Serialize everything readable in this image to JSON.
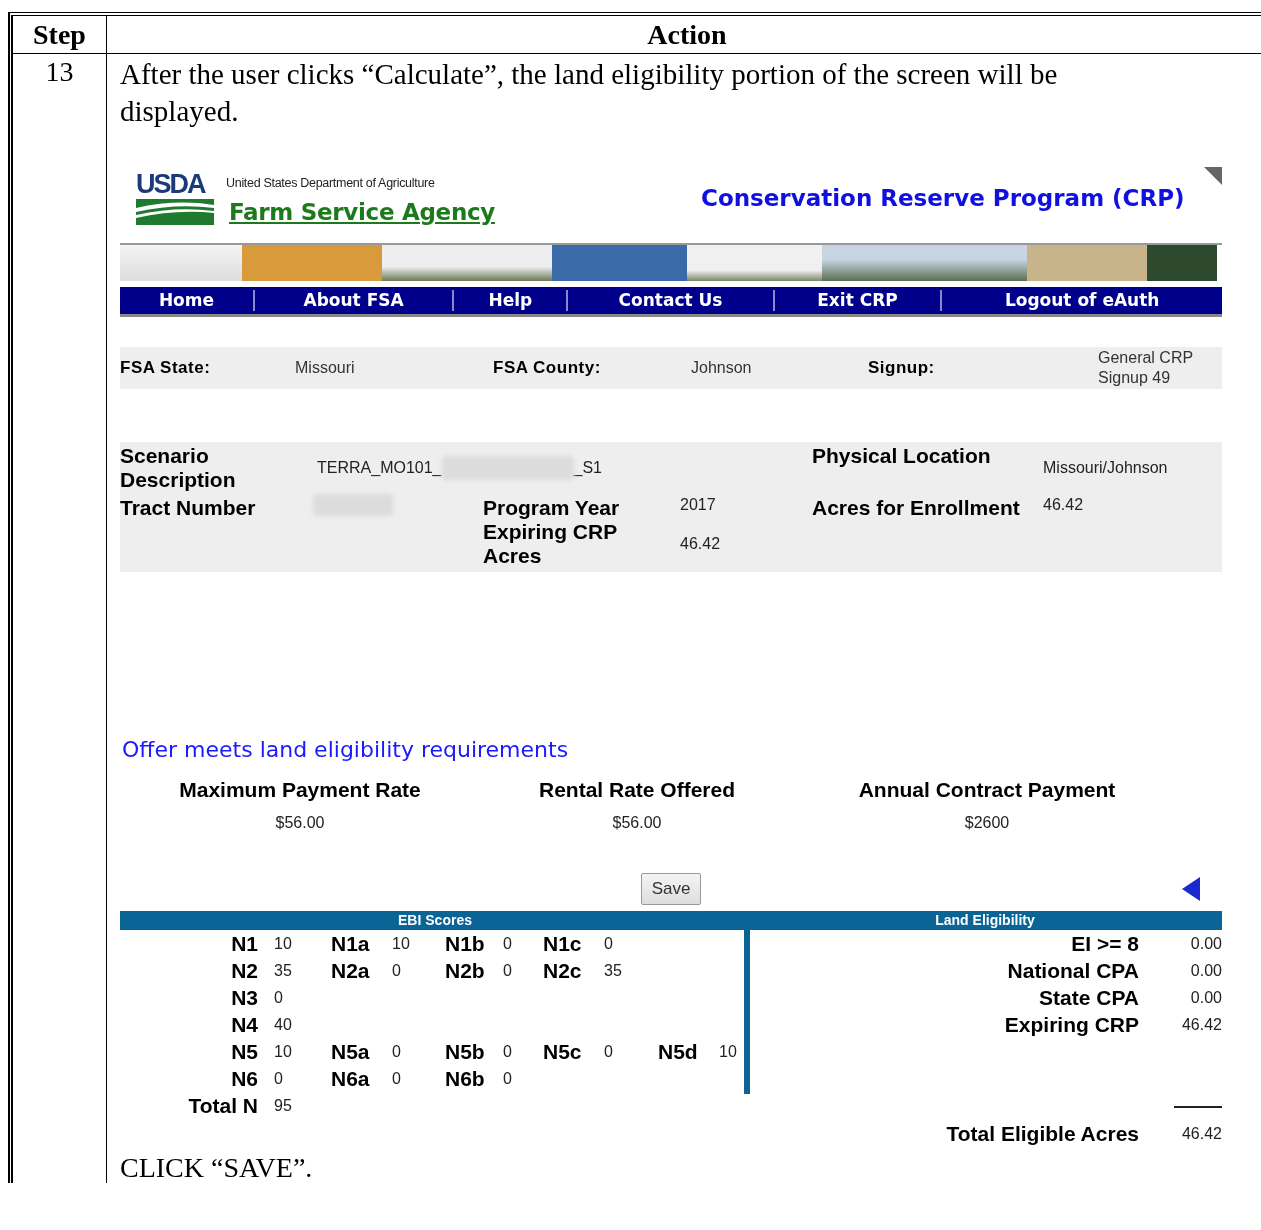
{
  "instruction_table": {
    "columns": [
      "Step",
      "Action"
    ],
    "step": "13",
    "intro": "After the user clicks “Calculate”, the land eligibility portion of the screen will be displayed.",
    "closing": "CLICK “SAVE”."
  },
  "screen": {
    "header": {
      "logo_text": "USDA",
      "department": "United States Department of Agriculture",
      "agency": "Farm Service Agency",
      "program_title": "Conservation Reserve Program (CRP)"
    },
    "nav": [
      {
        "label": "Home"
      },
      {
        "label": "About FSA"
      },
      {
        "label": "Help"
      },
      {
        "label": "Contact Us"
      },
      {
        "label": "Exit CRP"
      },
      {
        "label": "Logout of eAuth"
      }
    ],
    "location": [
      {
        "label": "FSA State:",
        "value": "Missouri"
      },
      {
        "label": "FSA County:",
        "value": "Johnson"
      },
      {
        "label": "Signup:",
        "value": "General CRP Signup 49"
      }
    ],
    "scenario": {
      "description_label": "Scenario Description",
      "description_prefix": "TERRA_MO101_",
      "description_suffix": "_S1",
      "tract_label": "Tract Number",
      "program_year_label": "Program Year",
      "program_year": "2017",
      "expiring_label": "Expiring CRP Acres",
      "expiring_value": "46.42",
      "location_label": "Physical Location",
      "location_value": "Missouri/Johnson",
      "enrollment_label": "Acres for Enrollment",
      "enrollment_value": "46.42"
    },
    "eligibility_message": "Offer meets land eligibility requirements",
    "payments": [
      {
        "label": "Maximum Payment Rate",
        "value": "$56.00"
      },
      {
        "label": "Rental Rate Offered",
        "value": "$56.00"
      },
      {
        "label": "Annual Contract Payment",
        "value": "$2600"
      }
    ],
    "save_button": "Save",
    "ebi_scores": {
      "title": "EBI Scores",
      "rows": [
        [
          {
            "label": "N1",
            "value": "10"
          },
          {
            "label": "N1a",
            "value": "10"
          },
          {
            "label": "N1b",
            "value": "0"
          },
          {
            "label": "N1c",
            "value": "0"
          }
        ],
        [
          {
            "label": "N2",
            "value": "35"
          },
          {
            "label": "N2a",
            "value": "0"
          },
          {
            "label": "N2b",
            "value": "0"
          },
          {
            "label": "N2c",
            "value": "35"
          }
        ],
        [
          {
            "label": "N3",
            "value": "0"
          }
        ],
        [
          {
            "label": "N4",
            "value": "40"
          }
        ],
        [
          {
            "label": "N5",
            "value": "10"
          },
          {
            "label": "N5a",
            "value": "0"
          },
          {
            "label": "N5b",
            "value": "0"
          },
          {
            "label": "N5c",
            "value": "0"
          },
          {
            "label": "N5d",
            "value": "10"
          }
        ],
        [
          {
            "label": "N6",
            "value": "0"
          },
          {
            "label": "N6a",
            "value": "0"
          },
          {
            "label": "N6b",
            "value": "0"
          }
        ]
      ],
      "total": {
        "label": "Total N",
        "value": "95"
      }
    },
    "land_eligibility": {
      "title": "Land Eligibility",
      "rows": [
        {
          "label": "EI >= 8",
          "value": "0.00"
        },
        {
          "label": "National CPA",
          "value": "0.00"
        },
        {
          "label": "State CPA",
          "value": "0.00"
        },
        {
          "label": "Expiring CRP",
          "value": "46.42"
        }
      ],
      "total": {
        "label": "Total Eligible Acres",
        "value": "46.42"
      }
    }
  }
}
